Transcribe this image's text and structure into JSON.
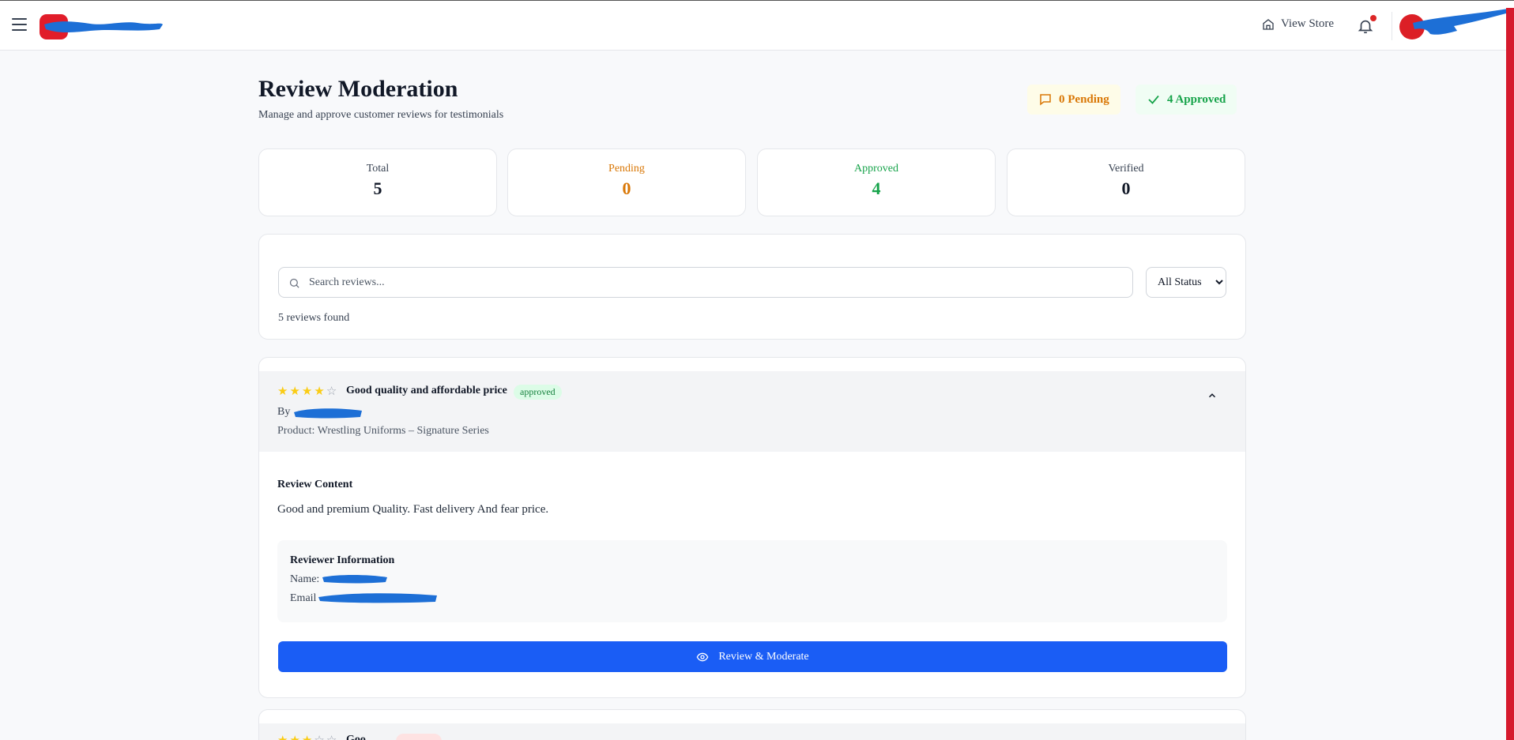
{
  "header": {
    "view_store_label": "View Store"
  },
  "page": {
    "title": "Review Moderation",
    "subtitle": "Manage and approve customer reviews for testimonials",
    "pending_pill": "0 Pending",
    "approved_pill": "4 Approved"
  },
  "stats": [
    {
      "label": "Total",
      "value": "5",
      "color": "#111827"
    },
    {
      "label": "Pending",
      "value": "0",
      "color": "#d97706"
    },
    {
      "label": "Approved",
      "value": "4",
      "color": "#16a34a"
    },
    {
      "label": "Verified",
      "value": "0",
      "color": "#111827"
    }
  ],
  "filters": {
    "search_placeholder": "Search reviews...",
    "status_selected": "All Status",
    "results_text": "5 reviews found"
  },
  "reviews": [
    {
      "rating": 4,
      "max_rating": 5,
      "title": "Good quality and affordable price",
      "status": "approved",
      "by_label": "By",
      "product": "Product: Wrestling Uniforms – Signature Series",
      "content_label": "Review Content",
      "content": "Good and premium Quality. Fast delivery And fear price.",
      "info_title": "Reviewer Information",
      "name_label": "Name:",
      "email_label": "Email",
      "action_label": "Review & Moderate"
    }
  ],
  "next_review": {
    "rating": 3,
    "title_partial": "Goo"
  },
  "icons": {
    "menu": "hamburger-icon",
    "home": "home-icon",
    "bell": "bell-icon",
    "message": "message-square-icon",
    "check": "check-icon",
    "search": "search-icon",
    "chevron": "chevron-up-icon",
    "eye": "eye-icon",
    "star": "star-icon"
  },
  "colors": {
    "brand_red": "#e11d2a",
    "primary_blue": "#1a5df5",
    "pending_amber": "#d97706",
    "approved_green": "#16a34a"
  }
}
